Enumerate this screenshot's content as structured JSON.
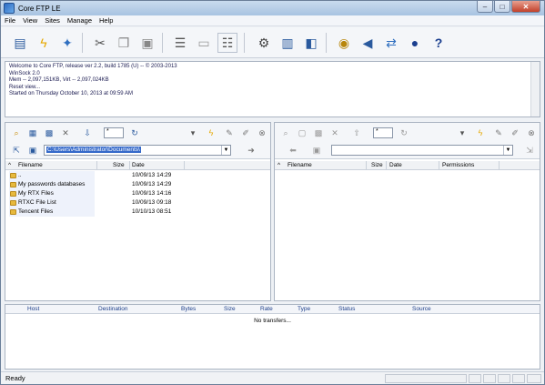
{
  "window": {
    "title": "Core FTP LE"
  },
  "menu": [
    "File",
    "View",
    "Sites",
    "Manage",
    "Help"
  ],
  "toolbar_icons": [
    "connect-icon",
    "quick-connect-icon",
    "disconnect-icon",
    "cut-icon",
    "copy-icon",
    "paste-icon",
    "view-log-icon",
    "text-mode-icon",
    "binary-mode-icon",
    "settings-icon",
    "site-profile-icon",
    "transfer-icon",
    "view-icon",
    "sound-icon",
    "sync-icon",
    "about-icon",
    "help-icon"
  ],
  "log": {
    "lines": [
      "Welcome to Core FTP, release ver 2.2, build 1785 (U) -- © 2003-2013",
      "WinSock 2.0",
      "Mem -- 2,097,151KB, Virt -- 2,097,024KB",
      "Reset view...",
      "Started on Thursday October 10, 2013 at 09:59 AM"
    ]
  },
  "local": {
    "spin_value": "*",
    "path": "C:\\Users\\Administrator\\Documents\\",
    "columns": {
      "filename": "Filename",
      "size": "Size",
      "date": "Date"
    },
    "rows": [
      {
        "name": "..",
        "date": "10/09/13  14:29"
      },
      {
        "name": "My passwords databases",
        "date": "10/09/13  14:29"
      },
      {
        "name": "My RTX Files",
        "date": "10/09/13  14:16"
      },
      {
        "name": "RTXC File List",
        "date": "10/09/13  09:18"
      },
      {
        "name": "Tencent Files",
        "date": "10/10/13  08:51"
      }
    ]
  },
  "remote": {
    "spin_value": "*",
    "path": "",
    "columns": {
      "filename": "Filename",
      "size": "Size",
      "date": "Date",
      "permissions": "Permissions"
    }
  },
  "queue": {
    "columns": [
      "Host",
      "Destination",
      "Bytes",
      "Size",
      "Rate",
      "Type",
      "Status",
      "Source"
    ],
    "empty_text": "No transfers..."
  },
  "status": {
    "text": "Ready"
  }
}
